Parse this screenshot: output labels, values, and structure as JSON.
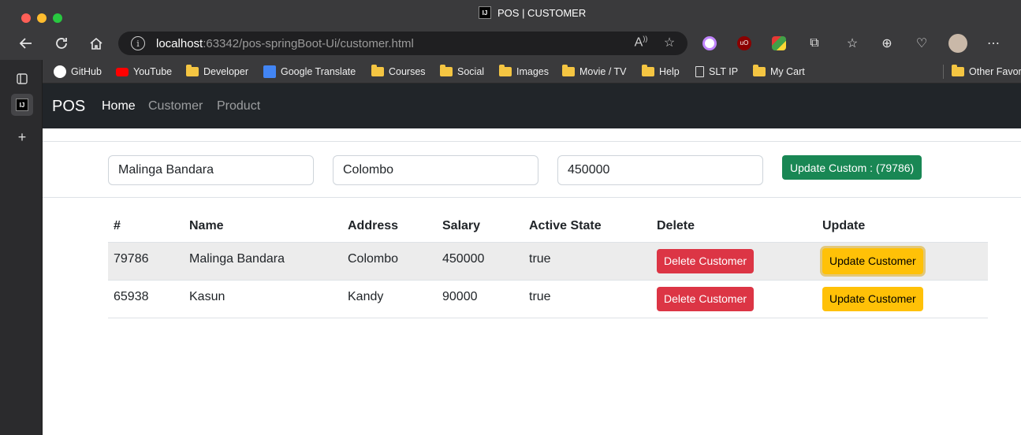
{
  "window": {
    "title": "POS | CUSTOMER",
    "tab_icon": "intellij-icon"
  },
  "browser": {
    "url_host": "localhost",
    "url_rest": ":63342/pos-springBoot-Ui/customer.html"
  },
  "bookmarks": [
    {
      "label": "GitHub",
      "icon": "github-icon"
    },
    {
      "label": "YouTube",
      "icon": "youtube-icon"
    },
    {
      "label": "Developer",
      "icon": "folder-icon"
    },
    {
      "label": "Google Translate",
      "icon": "google-translate-icon"
    },
    {
      "label": "Courses",
      "icon": "folder-icon"
    },
    {
      "label": "Social",
      "icon": "folder-icon"
    },
    {
      "label": "Images",
      "icon": "folder-icon"
    },
    {
      "label": "Movie / TV",
      "icon": "folder-icon"
    },
    {
      "label": "Help",
      "icon": "folder-icon"
    },
    {
      "label": "SLT IP",
      "icon": "page-icon"
    },
    {
      "label": "My Cart",
      "icon": "folder-icon"
    },
    {
      "label": "Other Favor",
      "icon": "folder-icon"
    }
  ],
  "navbar": {
    "brand": "POS",
    "links": [
      "Home",
      "Customer",
      "Product"
    ]
  },
  "form": {
    "name_value": "Malinga Bandara",
    "address_value": "Colombo",
    "salary_value": "450000",
    "submit_label": "Update Custom : (79786)"
  },
  "table": {
    "headers": [
      "#",
      "Name",
      "Address",
      "Salary",
      "Active State",
      "Delete",
      "Update"
    ],
    "rows": [
      {
        "id": "79786",
        "name": "Malinga Bandara",
        "address": "Colombo",
        "salary": "450000",
        "active": "true",
        "delete_label": "Delete Customer",
        "update_label": "Update Customer"
      },
      {
        "id": "65938",
        "name": "Kasun",
        "address": "Kandy",
        "salary": "90000",
        "active": "true",
        "delete_label": "Delete Customer",
        "update_label": "Update Customer"
      }
    ]
  },
  "colors": {
    "success": "#198754",
    "danger": "#dc3545",
    "warning": "#ffc107",
    "navbar_bg": "#212529"
  }
}
